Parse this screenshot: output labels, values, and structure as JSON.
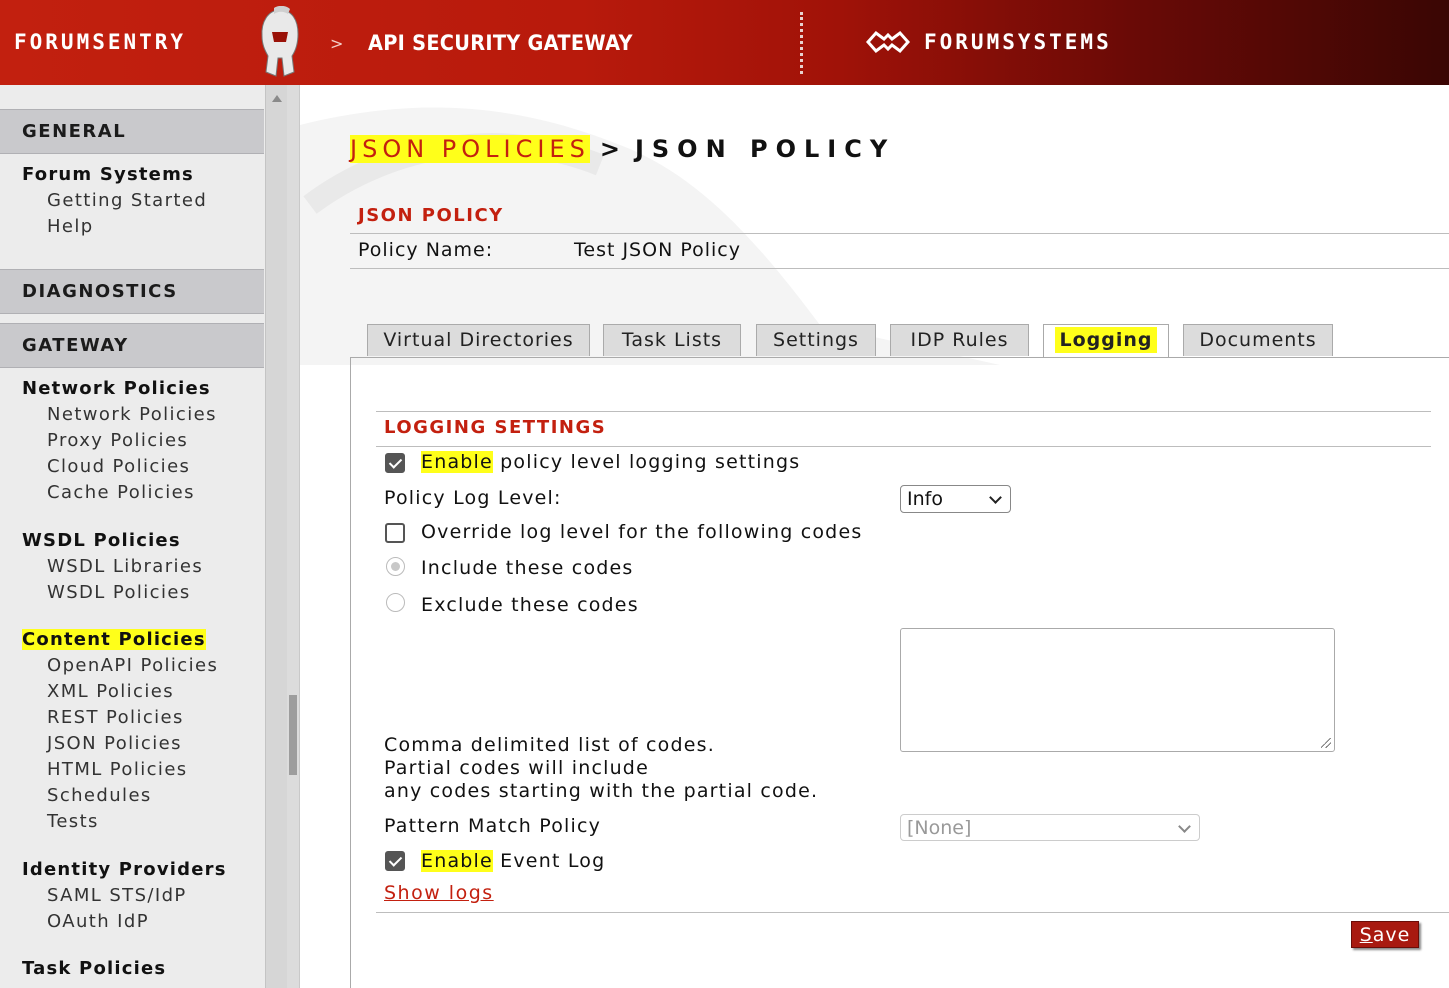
{
  "header": {
    "logo_left": "FORUMSENTRY",
    "product": "API SECURITY GATEWAY",
    "chevron": ">",
    "logo_right": "FORUMSYSTEMS"
  },
  "sidebar": {
    "general": {
      "title": "GENERAL",
      "group": "Forum Systems",
      "items": [
        "Getting Started",
        "Help"
      ]
    },
    "diagnostics": {
      "title": "DIAGNOSTICS"
    },
    "gateway": {
      "title": "GATEWAY",
      "network": {
        "label": "Network Policies",
        "items": [
          "Network Policies",
          "Proxy Policies",
          "Cloud Policies",
          "Cache Policies"
        ]
      },
      "wsdl": {
        "label": "WSDL Policies",
        "items": [
          "WSDL Libraries",
          "WSDL Policies"
        ]
      },
      "content": {
        "label": "Content Policies",
        "items": [
          "OpenAPI Policies",
          "XML Policies",
          "REST Policies",
          "JSON Policies",
          "HTML Policies",
          "Schedules",
          "Tests"
        ]
      },
      "identity": {
        "label": "Identity Providers",
        "items": [
          "SAML STS/IdP",
          "OAuth IdP"
        ]
      },
      "task": {
        "label": "Task Policies"
      }
    }
  },
  "breadcrumb": {
    "link": "JSON POLICIES",
    "separator": ">",
    "current": "JSON POLICY"
  },
  "panel": {
    "title": "JSON POLICY",
    "policy_name_label": "Policy Name:",
    "policy_name_value": "Test JSON Policy"
  },
  "tabs": [
    {
      "label": "Virtual Directories"
    },
    {
      "label": "Task Lists"
    },
    {
      "label": "Settings"
    },
    {
      "label": "IDP Rules"
    },
    {
      "label": "Logging",
      "active": true
    },
    {
      "label": "Documents"
    }
  ],
  "logging": {
    "title": "LOGGING SETTINGS",
    "enable_policy": {
      "highlight": "Enable",
      "rest": " policy level logging settings",
      "checked": true
    },
    "log_level_label": "Policy Log Level:",
    "log_level_value": "Info",
    "override": {
      "label": "Override log level for the following codes",
      "checked": false
    },
    "include": {
      "label": "Include these codes",
      "selected": true
    },
    "exclude": {
      "label": "Exclude these codes",
      "selected": false
    },
    "codes_help": [
      "Comma delimited list of codes.",
      "Partial codes will include",
      "any codes starting with the partial code."
    ],
    "codes_value": "",
    "pattern_label": "Pattern Match Policy",
    "pattern_value": "[None]",
    "enable_event": {
      "highlight": "Enable",
      "rest": " Event Log",
      "checked": true
    },
    "show_logs": "Show logs"
  },
  "save": {
    "first": "S",
    "rest": "ave"
  },
  "colors": {
    "brand_red": "#c3200f",
    "highlight": "#ffff1a",
    "header_dark": "#3a0604"
  }
}
